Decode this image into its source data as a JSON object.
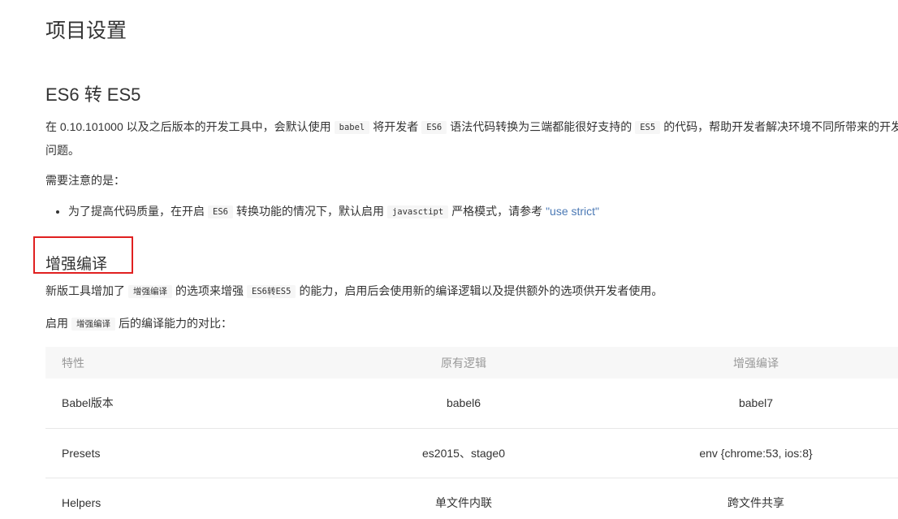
{
  "page_title": "项目设置",
  "section1": {
    "title": "ES6 转 ES5",
    "para1": {
      "t1": "在 0.10.101000 以及之后版本的开发工具中，会默认使用",
      "c1": "babel",
      "t2": "将开发者",
      "c2": "ES6",
      "t3": "语法代码转换为三端都能很好支持的",
      "c3": "ES5",
      "t4": "的代码，帮助开发者解决环境不同所带来的开发问题。"
    },
    "note_label": "需要注意的是：",
    "bullet": {
      "t1": "为了提高代码质量，在开启",
      "c1": "ES6",
      "t2": "转换功能的情况下，默认启用",
      "c2": "javasctipt",
      "t3": "严格模式，请参考",
      "link": "\"use strict\""
    }
  },
  "section2": {
    "title": "增强编译",
    "para1": {
      "t1": "新版工具增加了",
      "c1": "增强编译",
      "t2": "的选项来增强",
      "c2": "ES6转ES5",
      "t3": "的能力，启用后会使用新的编译逻辑以及提供额外的选项供开发者使用。"
    },
    "para2": {
      "t1": "启用",
      "c1": "增强编译",
      "t2": "后的编译能力的对比："
    },
    "table": {
      "headers": [
        "特性",
        "原有逻辑",
        "增强编译"
      ],
      "rows": [
        [
          "Babel版本",
          "babel6",
          "babel7"
        ],
        [
          "Presets",
          "es2015、stage0",
          "env {chrome:53, ios:8}"
        ],
        [
          "Helpers",
          "单文件内联",
          "跨文件共享"
        ]
      ]
    }
  },
  "colors": {
    "text": "#333333",
    "muted": "#999999",
    "link": "#4b79b5",
    "highlight_border": "#e02020",
    "table_header_bg": "#f7f7f7",
    "code_bg": "#f6f6f6"
  }
}
